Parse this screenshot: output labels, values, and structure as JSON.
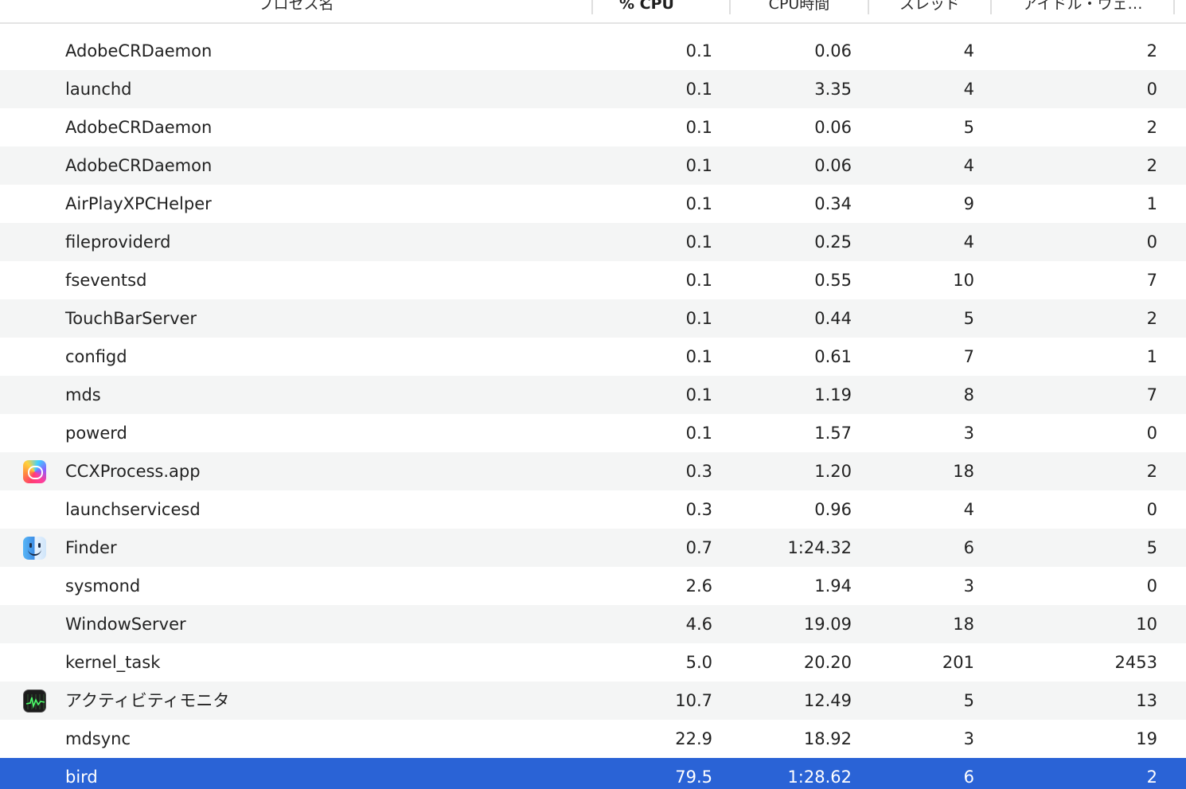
{
  "columns": {
    "name": "プロセス名",
    "cpu": "% CPU",
    "cpu_time": "CPU時間",
    "threads": "スレッド",
    "idle_wakeups": "アイドル・ウェ…",
    "sort_indicator": "^"
  },
  "rows": [
    {
      "name": "AdobeCRDaemon",
      "cpu": "0.1",
      "cpu_time": "0.06",
      "threads": "4",
      "idle": "2",
      "icon": ""
    },
    {
      "name": "launchd",
      "cpu": "0.1",
      "cpu_time": "3.35",
      "threads": "4",
      "idle": "0",
      "icon": ""
    },
    {
      "name": "AdobeCRDaemon",
      "cpu": "0.1",
      "cpu_time": "0.06",
      "threads": "5",
      "idle": "2",
      "icon": ""
    },
    {
      "name": "AdobeCRDaemon",
      "cpu": "0.1",
      "cpu_time": "0.06",
      "threads": "4",
      "idle": "2",
      "icon": ""
    },
    {
      "name": "AirPlayXPCHelper",
      "cpu": "0.1",
      "cpu_time": "0.34",
      "threads": "9",
      "idle": "1",
      "icon": ""
    },
    {
      "name": "fileproviderd",
      "cpu": "0.1",
      "cpu_time": "0.25",
      "threads": "4",
      "idle": "0",
      "icon": ""
    },
    {
      "name": "fseventsd",
      "cpu": "0.1",
      "cpu_time": "0.55",
      "threads": "10",
      "idle": "7",
      "icon": ""
    },
    {
      "name": "TouchBarServer",
      "cpu": "0.1",
      "cpu_time": "0.44",
      "threads": "5",
      "idle": "2",
      "icon": ""
    },
    {
      "name": "configd",
      "cpu": "0.1",
      "cpu_time": "0.61",
      "threads": "7",
      "idle": "1",
      "icon": ""
    },
    {
      "name": "mds",
      "cpu": "0.1",
      "cpu_time": "1.19",
      "threads": "8",
      "idle": "7",
      "icon": ""
    },
    {
      "name": "powerd",
      "cpu": "0.1",
      "cpu_time": "1.57",
      "threads": "3",
      "idle": "0",
      "icon": ""
    },
    {
      "name": "CCXProcess.app",
      "cpu": "0.3",
      "cpu_time": "1.20",
      "threads": "18",
      "idle": "2",
      "icon": "creative-cloud-icon"
    },
    {
      "name": "launchservicesd",
      "cpu": "0.3",
      "cpu_time": "0.96",
      "threads": "4",
      "idle": "0",
      "icon": ""
    },
    {
      "name": "Finder",
      "cpu": "0.7",
      "cpu_time": "1:24.32",
      "threads": "6",
      "idle": "5",
      "icon": "finder-icon"
    },
    {
      "name": "sysmond",
      "cpu": "2.6",
      "cpu_time": "1.94",
      "threads": "3",
      "idle": "0",
      "icon": ""
    },
    {
      "name": "WindowServer",
      "cpu": "4.6",
      "cpu_time": "19.09",
      "threads": "18",
      "idle": "10",
      "icon": ""
    },
    {
      "name": "kernel_task",
      "cpu": "5.0",
      "cpu_time": "20.20",
      "threads": "201",
      "idle": "2453",
      "icon": ""
    },
    {
      "name": "アクティビティモニタ",
      "cpu": "10.7",
      "cpu_time": "12.49",
      "threads": "5",
      "idle": "13",
      "icon": "activity-monitor-icon"
    },
    {
      "name": "mdsync",
      "cpu": "22.9",
      "cpu_time": "18.92",
      "threads": "3",
      "idle": "19",
      "icon": ""
    },
    {
      "name": "bird",
      "cpu": "79.5",
      "cpu_time": "1:28.62",
      "threads": "6",
      "idle": "2",
      "icon": "",
      "selected": true
    }
  ],
  "colors": {
    "selection": "#2a63d6",
    "alt_row": "#f4f5f5",
    "text": "#222222"
  }
}
